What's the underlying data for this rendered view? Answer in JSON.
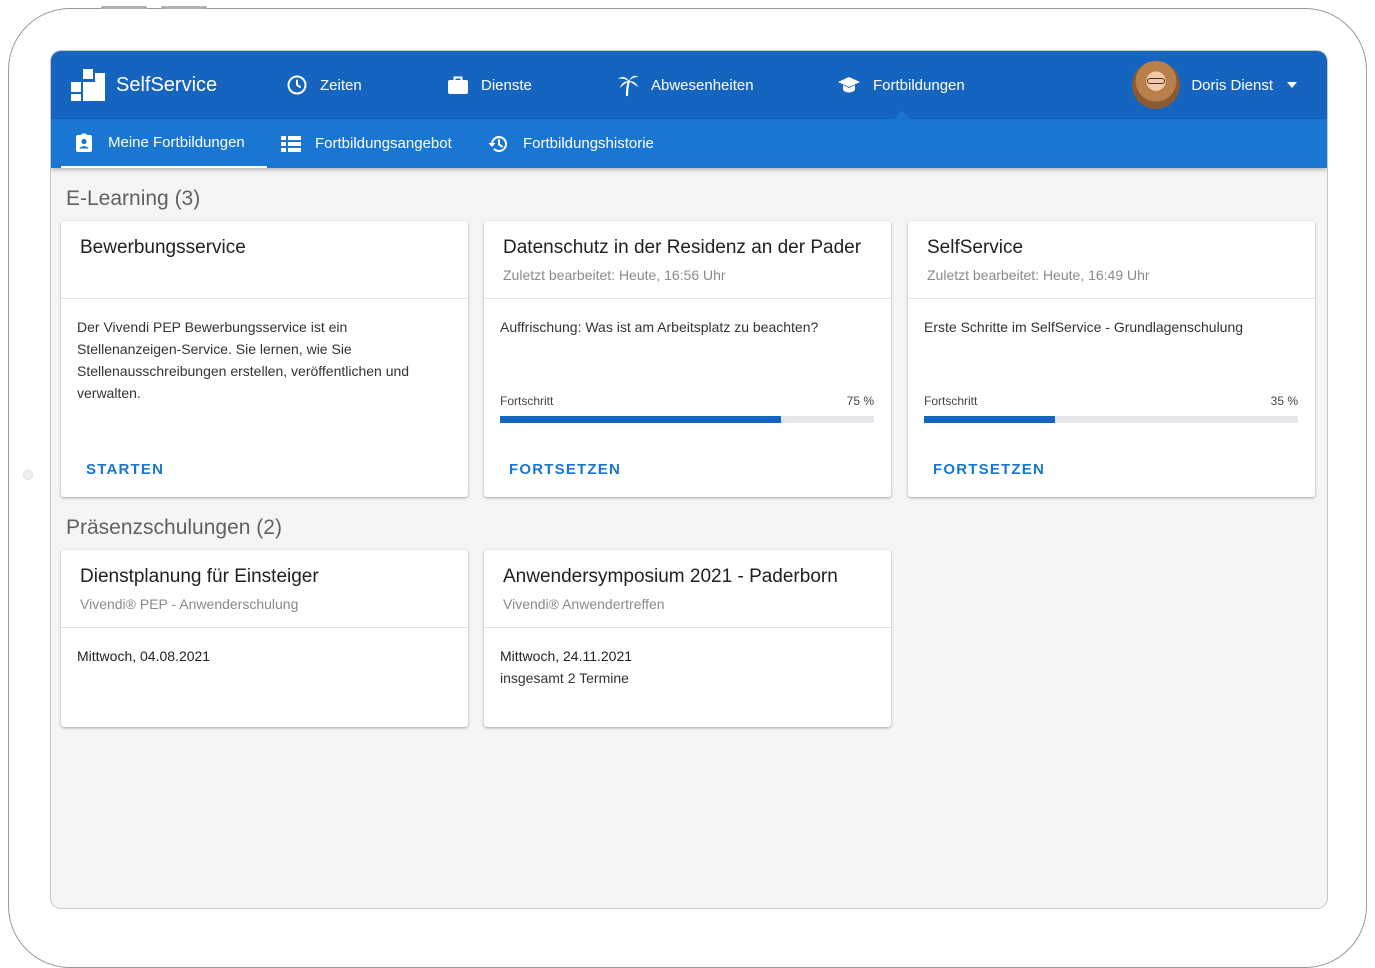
{
  "app": {
    "title": "SelfService"
  },
  "nav": {
    "items": [
      {
        "label": "Zeiten",
        "icon": "clock-icon"
      },
      {
        "label": "Dienste",
        "icon": "briefcase-icon"
      },
      {
        "label": "Abwesenheiten",
        "icon": "palm-tree-icon"
      },
      {
        "label": "Fortbildungen",
        "icon": "graduation-cap-icon",
        "active": true
      }
    ],
    "user": {
      "name": "Doris Dienst"
    }
  },
  "subnav": {
    "items": [
      {
        "label": "Meine Fortbildungen",
        "icon": "id-badge-icon",
        "active": true
      },
      {
        "label": "Fortbildungsangebot",
        "icon": "list-icon"
      },
      {
        "label": "Fortbildungshistorie",
        "icon": "history-icon"
      }
    ]
  },
  "elearning": {
    "title": "E-Learning (3)",
    "cards": [
      {
        "title": "Bewerbungsservice",
        "subtitle": "",
        "description": "Der Vivendi PEP Bewerbungsservice ist ein Stellenanzeigen-Service. Sie lernen, wie Sie Stellenausschreibungen erstellen, veröffentlichen und verwalten.",
        "action": "STARTEN"
      },
      {
        "title": "Datenschutz in der Residenz an der Pader",
        "subtitle": "Zuletzt bearbeitet: Heute, 16:56 Uhr",
        "description": "Auffrischung: Was ist am Arbeitsplatz zu beachten?",
        "progress_label": "Fortschritt",
        "progress_value": "75 %",
        "progress": 0.75,
        "action": "FORTSETZEN"
      },
      {
        "title": "SelfService",
        "subtitle": "Zuletzt bearbeitet: Heute, 16:49 Uhr",
        "description": "Erste Schritte im SelfService - Grundlagenschulung",
        "progress_label": "Fortschritt",
        "progress_value": "35 %",
        "progress": 0.35,
        "action": "FORTSETZEN"
      }
    ]
  },
  "praesenz": {
    "title": "Präsenzschulungen (2)",
    "cards": [
      {
        "title": "Dienstplanung für Einsteiger",
        "subtitle": "Vivendi® PEP - Anwenderschulung",
        "date": "Mittwoch, 04.08.2021",
        "note": ""
      },
      {
        "title": "Anwendersymposium 2021 - Paderborn",
        "subtitle": "Vivendi® Anwendertreffen",
        "date": "Mittwoch, 24.11.2021",
        "note": "insgesamt 2 Termine"
      }
    ]
  },
  "colors": {
    "primary": "#1565c0",
    "secondary": "#1976d2",
    "background": "#f5f5f5"
  }
}
